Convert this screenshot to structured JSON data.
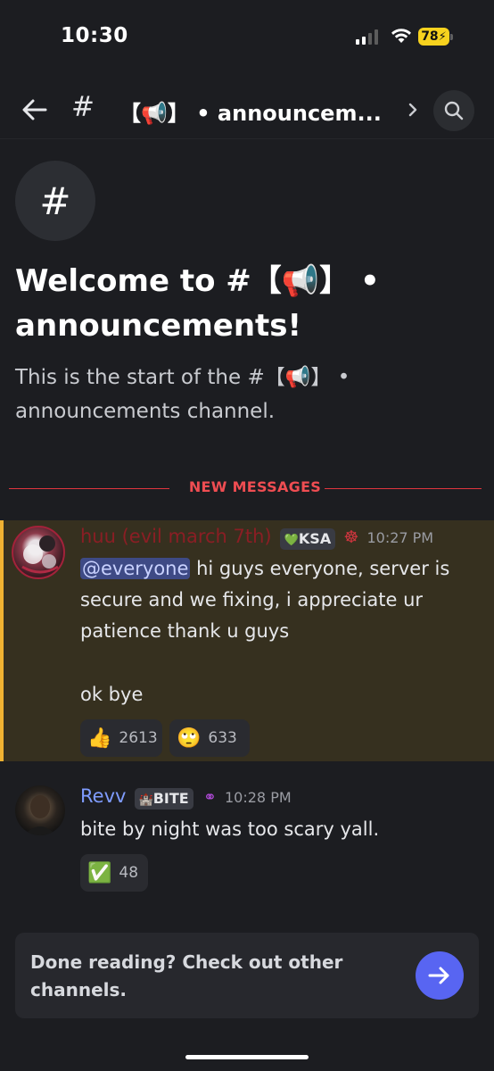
{
  "status_bar": {
    "time": "10:30",
    "battery": "78"
  },
  "header": {
    "hash": "#",
    "channel_name": "【📢】 • announcem..."
  },
  "welcome": {
    "icon_glyph": "#",
    "title": "Welcome to #【📢】 • announcements!",
    "subtitle": "This is the start of the #【📢】 • announcements channel."
  },
  "divider": {
    "label": "NEW MESSAGES"
  },
  "messages": [
    {
      "username": "huu (evil march 7th)",
      "username_color": "#8a1e24",
      "role_icon": "💚",
      "role_tag": "KSA",
      "badge_icon": "☸",
      "timestamp": "10:27 PM",
      "mention": "@everyone",
      "text_after_mention": " hi guys everyone, server is secure and we fixing, i appreciate ur patience thank u guys",
      "text_line2": "ok bye",
      "reactions": [
        {
          "emoji": "👍",
          "count": "2613"
        },
        {
          "emoji": "🙄",
          "count": "633"
        }
      ]
    },
    {
      "username": "Revv",
      "username_color": "#7f9cff",
      "role_icon": "🏰",
      "role_tag": "BITE",
      "badge_icon": "⚭",
      "timestamp": "10:28 PM",
      "text": "bite by night was too scary yall.",
      "reactions": [
        {
          "emoji": "✅",
          "count": "48"
        }
      ]
    }
  ],
  "prompt": {
    "text": "Done reading? Check out other channels."
  },
  "colors": {
    "background": "#1c1d21",
    "accent": "#5865f2",
    "new_messages_red": "#ef4d52",
    "highlight_bar": "#f0b232"
  }
}
